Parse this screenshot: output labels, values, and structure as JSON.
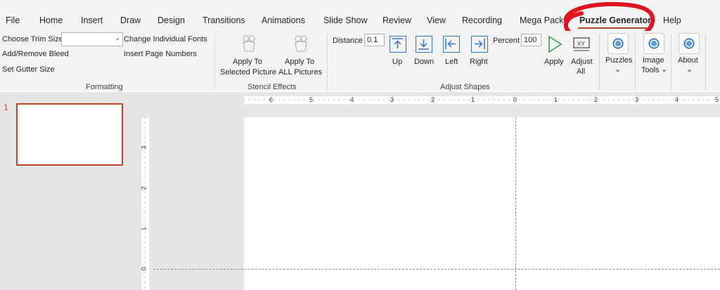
{
  "tabs": [
    {
      "label": "File"
    },
    {
      "label": "Home"
    },
    {
      "label": "Insert"
    },
    {
      "label": "Draw"
    },
    {
      "label": "Design"
    },
    {
      "label": "Transitions"
    },
    {
      "label": "Animations"
    },
    {
      "label": "Slide Show"
    },
    {
      "label": "Review"
    },
    {
      "label": "View"
    },
    {
      "label": "Recording"
    },
    {
      "label": "Mega Pack"
    },
    {
      "label": "Puzzle Generator",
      "active": true
    },
    {
      "label": "Help"
    }
  ],
  "formatting": {
    "trim_size_label": "Choose Trim Size",
    "trim_size_value": "",
    "change_fonts": "Change Individual Fonts",
    "add_remove_bleed": "Add/Remove Bleed",
    "insert_page_numbers": "Insert Page Numbers",
    "gutter_size": "Set Gutter Size",
    "group_label": "Formatting"
  },
  "stencil": {
    "apply_selected_line1": "Apply To",
    "apply_selected_line2": "Selected Picture",
    "apply_all_line1": "Apply To",
    "apply_all_line2": "ALL Pictures",
    "group_label": "Stencil Effects"
  },
  "adjust": {
    "distance_label": "Distance",
    "distance_value": "0.1",
    "up": "Up",
    "down": "Down",
    "left": "Left",
    "right": "Right",
    "percent_label": "Percent",
    "percent_value": "100",
    "apply": "Apply",
    "adjust_all_line1": "Adjust",
    "adjust_all_line2": "All",
    "group_label": "Adjust Shapes"
  },
  "puzzles": {
    "label": "Puzzles"
  },
  "image_tools": {
    "line1": "Image",
    "line2": "Tools"
  },
  "about": {
    "label": "About"
  },
  "slides": {
    "number": "1"
  },
  "ruler": {
    "h_labels": [
      "6",
      "5",
      "4",
      "3",
      "2",
      "1",
      "0",
      "1",
      "2",
      "3",
      "4",
      "5"
    ],
    "v_labels": [
      "3",
      "2",
      "1",
      "0"
    ]
  },
  "colors": {
    "accent": "#b7472a",
    "annotation": "#e0141e",
    "icon_blue": "#2f77bf"
  }
}
